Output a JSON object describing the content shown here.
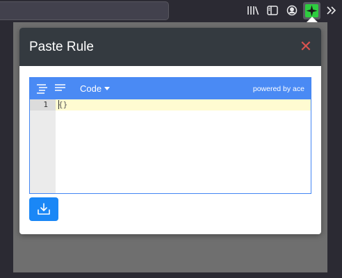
{
  "browser": {
    "toolbar_icons": [
      "library-icon",
      "sidebar-icon",
      "account-icon",
      "extension-icon",
      "overflow-icon"
    ],
    "accent_color": "#2b2a33"
  },
  "modal": {
    "title": "Paste Rule",
    "close_label": "✕",
    "header_color": "#343a40",
    "close_color": "#d9534f"
  },
  "editor": {
    "mode_label": "Code",
    "powered_by": "powered by ace",
    "line_numbers": [
      "1"
    ],
    "content": "{}",
    "bar_color": "#4a8af4"
  },
  "actions": {
    "download_icon": "download-icon",
    "button_color": "#1a87f6"
  }
}
